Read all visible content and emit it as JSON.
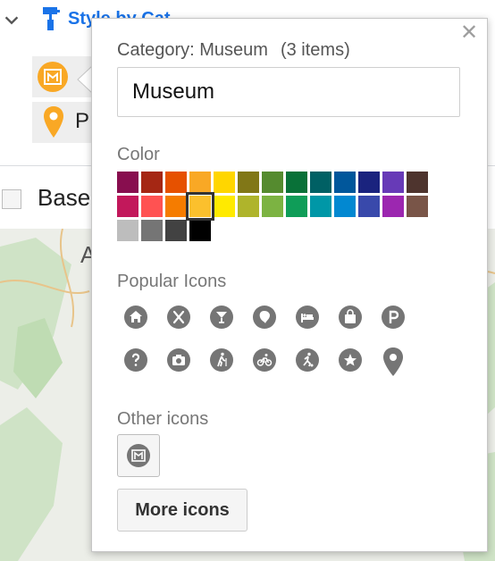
{
  "background": {
    "style_link": "Style by Cat",
    "layer_letter": "P",
    "base_label": "Base",
    "map_letter": "A"
  },
  "popup": {
    "close_glyph": "✕",
    "category_prefix": "Category: Museum",
    "item_count": "(3 items)",
    "name_value": "Museum",
    "color_label": "Color",
    "popular_label": "Popular Icons",
    "other_label": "Other icons",
    "more_button": "More icons"
  },
  "colors": {
    "selected": "#fbc02d",
    "rows": [
      [
        "#880e4f",
        "#a52714",
        "#e65100",
        "#f9a825",
        "#ffd600",
        "#817717",
        "#558b2f",
        "#097138",
        "#006064",
        "#01579b",
        "#1a237e",
        "#673ab7",
        "#4e342e"
      ],
      [
        "#c2185b",
        "#ff5252",
        "#f57c00",
        "#fbc02d",
        "#ffea00",
        "#afb42b",
        "#7cb342",
        "#0f9d58",
        "#0097a7",
        "#0288d1",
        "#3949ab",
        "#9c27b0",
        "#795548"
      ],
      [
        "#bdbdbd",
        "#757575",
        "#424242",
        "#000000"
      ]
    ]
  },
  "popular_icons": [
    [
      "home-icon",
      "restaurant-icon",
      "bar-icon",
      "nature-icon",
      "hotel-icon",
      "shopping-icon",
      "parking-icon"
    ],
    [
      "help-icon",
      "camera-icon",
      "hiking-icon",
      "cycling-icon",
      "sports-icon",
      "star-icon",
      "place-pin-icon"
    ]
  ],
  "other_icons": [
    "museum-icon"
  ]
}
